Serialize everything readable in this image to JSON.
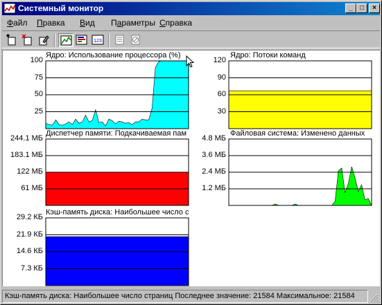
{
  "window": {
    "title": "Системный монитор",
    "controls": {
      "minimize": "_",
      "maximize": "□",
      "close": "×"
    }
  },
  "menu": [
    {
      "label": "Файл",
      "accesskey": "Ф",
      "rest": "айл"
    },
    {
      "label": "Правка",
      "accesskey": "П",
      "rest": "равка"
    },
    {
      "label": "Вид",
      "accesskey": "В",
      "rest": "ид"
    },
    {
      "label": "Параметры",
      "accesskey": "а",
      "rest": "раметры",
      "prefix": "П"
    },
    {
      "label": "Справка",
      "accesskey": "С",
      "rest": "правка"
    }
  ],
  "toolbar": {
    "tools": [
      {
        "name": "new-chart-icon"
      },
      {
        "name": "delete-chart-icon"
      },
      {
        "name": "edit-chart-icon"
      },
      {
        "name": "line-view-icon",
        "pressed": true
      },
      {
        "name": "bar-view-icon"
      },
      {
        "name": "numeric-view-icon",
        "text": "123"
      },
      {
        "name": "options-icon"
      },
      {
        "name": "clear-icon"
      }
    ]
  },
  "colors": {
    "cpu": "#00ffff",
    "threads": "#ffff00",
    "memory": "#ff0000",
    "filesystem": "#00ff00",
    "cache": "#0000ff"
  },
  "chart_data": [
    {
      "type": "area",
      "title": "Ядро: Использование процессора (%)",
      "ylim": [
        0,
        100
      ],
      "yticks": [
        "100",
        "75",
        "50",
        "25"
      ],
      "ytick_values": [
        100,
        75,
        50,
        25
      ],
      "color": "#00ffff",
      "values": [
        8,
        6,
        5,
        13,
        6,
        5,
        7,
        10,
        6,
        14,
        8,
        10,
        20,
        10,
        12,
        28,
        9,
        10,
        4,
        14,
        12,
        7,
        11,
        10,
        8,
        9,
        6,
        10,
        10,
        14,
        13,
        13,
        30,
        90,
        99,
        100,
        100,
        100,
        100,
        100,
        100,
        100,
        100,
        100
      ]
    },
    {
      "type": "area",
      "title": "Ядро: Потоки команд",
      "ylim": [
        0,
        120
      ],
      "yticks": [
        "120",
        "90",
        "60",
        "30"
      ],
      "ytick_values": [
        120,
        90,
        60,
        30
      ],
      "color": "#ffff00",
      "values": [
        67,
        67,
        67,
        67,
        67,
        67,
        67,
        67,
        67,
        67,
        67,
        67,
        67,
        67,
        67,
        67,
        67,
        67,
        67,
        67,
        67,
        67,
        67,
        67,
        67,
        67,
        67,
        67,
        67,
        67,
        67,
        67,
        67,
        67,
        67,
        67,
        67,
        67,
        67,
        67,
        67,
        67,
        67,
        67
      ]
    },
    {
      "type": "area",
      "title": "Диспетчер памяти: Подкачиваемая пам",
      "ylim": [
        0,
        244.1
      ],
      "yticks": [
        "244.1 МБ",
        "183.1 МБ",
        "122 МБ",
        "61 МБ"
      ],
      "ytick_values": [
        244.1,
        183.1,
        122,
        61
      ],
      "color": "#ff0000",
      "values": [
        122,
        122,
        122,
        122,
        122,
        122,
        122,
        122,
        122,
        122,
        122,
        122,
        122,
        122,
        122,
        122,
        122,
        122,
        122,
        122,
        122,
        122,
        122,
        122,
        122,
        122,
        122,
        122,
        122,
        122,
        122,
        122,
        122,
        122,
        122,
        122,
        122,
        122,
        122,
        122,
        122,
        122,
        122,
        122
      ]
    },
    {
      "type": "area",
      "title": "Файловая система: Изменено данных",
      "ylim": [
        0,
        4.8
      ],
      "yticks": [
        "4.8 МБ",
        "3.6 МБ",
        "2.4 МБ",
        "1.2 МБ"
      ],
      "ytick_values": [
        4.8,
        3.6,
        2.4,
        1.2
      ],
      "color": "#00ff00",
      "values": [
        0,
        0,
        0,
        0,
        0,
        0,
        0,
        0,
        0,
        0,
        0,
        0,
        0,
        0,
        0.1,
        0,
        0,
        0,
        0,
        0,
        0.1,
        0,
        0,
        0,
        0,
        0,
        0,
        0,
        0,
        0,
        0,
        0,
        0.3,
        2.5,
        2.7,
        0.9,
        1.6,
        2.8,
        2.0,
        1.0,
        1.5,
        0.4,
        0.5,
        0
      ]
    },
    {
      "type": "area",
      "title": "Кэш-память диска: Наибольшее число с",
      "ylim": [
        0,
        29.2
      ],
      "yticks": [
        "29.2 КБ",
        "21.9 КБ",
        "14.6 КБ",
        "7.3 КБ"
      ],
      "ytick_values": [
        29.2,
        21.9,
        14.6,
        7.3
      ],
      "color": "#0000ff",
      "values": [
        21.1,
        21.1,
        21.1,
        21.1,
        21.1,
        21.1,
        21.1,
        21.1,
        21.1,
        21.1,
        21.1,
        21.1,
        21.1,
        21.1,
        21.1,
        21.1,
        21.1,
        21.1,
        21.1,
        21.1,
        21.1,
        21.1,
        21.1,
        21.1,
        21.1,
        21.1,
        21.1,
        21.1,
        21.1,
        21.1,
        21.1,
        21.1,
        21.1,
        21.1,
        21.1,
        21.1,
        21.1,
        21.1,
        21.1,
        21.1,
        21.1,
        21.1,
        21.1,
        21.1
      ]
    }
  ],
  "status": {
    "text": "Кэш-память диска: Наибольшее число страниц  Последнее значение: 21584  Максимальное: 21584"
  }
}
